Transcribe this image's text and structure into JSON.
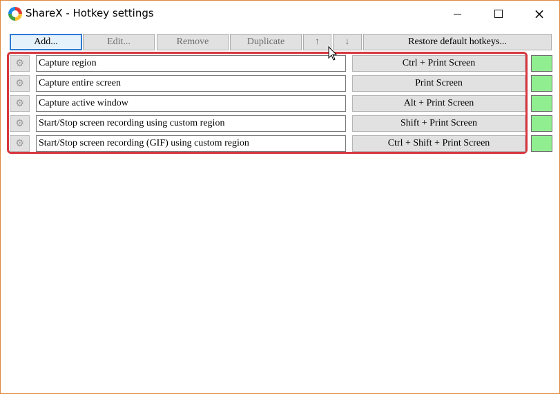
{
  "window": {
    "title": "ShareX - Hotkey settings",
    "min_icon": "minimize-icon",
    "max_icon": "maximize-icon",
    "close_icon": "close-icon",
    "close_glyph": "×"
  },
  "toolbar": {
    "add_label": "Add...",
    "edit_label": "Edit...",
    "remove_label": "Remove",
    "duplicate_label": "Duplicate",
    "move_up_label": "↑",
    "move_down_label": "↓",
    "restore_label": "Restore default hotkeys..."
  },
  "colors": {
    "highlight": "#d7373f",
    "status_ok": "#90ee90",
    "focus_border": "#2d7ad6"
  },
  "hotkeys": [
    {
      "description": "Capture region",
      "hotkey": "Ctrl + Print Screen",
      "status": "ok"
    },
    {
      "description": "Capture entire screen",
      "hotkey": "Print Screen",
      "status": "ok"
    },
    {
      "description": "Capture active window",
      "hotkey": "Alt + Print Screen",
      "status": "ok"
    },
    {
      "description": "Start/Stop screen recording using custom region",
      "hotkey": "Shift + Print Screen",
      "status": "ok"
    },
    {
      "description": "Start/Stop screen recording (GIF) using custom region",
      "hotkey": "Ctrl + Shift + Print Screen",
      "status": "ok"
    }
  ],
  "row_icon": "gear-icon"
}
